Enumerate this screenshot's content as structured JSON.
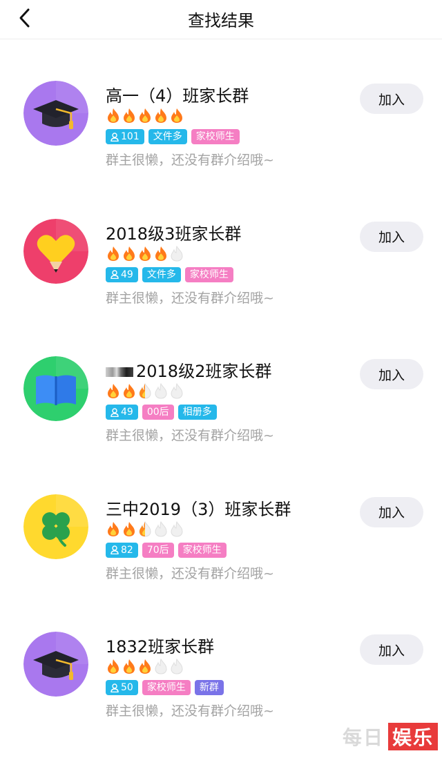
{
  "header": {
    "title": "查找结果"
  },
  "groups": [
    {
      "name": "高一（4）班家长群",
      "heat": 5,
      "members": "101",
      "tags": [
        "文件多",
        "家校师生"
      ],
      "tag_colors": [
        "blue",
        "pink"
      ],
      "desc": "群主很懒，还没有群介绍哦~",
      "join": "加入",
      "avatar_icon": "graduation-cap-icon",
      "avatar_color": "#a978ee"
    },
    {
      "name": "2018级3班家长群",
      "heat": 4,
      "members": "49",
      "tags": [
        "文件多",
        "家校师生"
      ],
      "tag_colors": [
        "blue",
        "pink"
      ],
      "desc": "群主很懒，还没有群介绍哦~",
      "join": "加入",
      "avatar_icon": "heart-pencil-icon",
      "avatar_color": "#ee3f6b"
    },
    {
      "name": "2018级2班家长群",
      "heat": 2.5,
      "members": "49",
      "tags": [
        "00后",
        "相册多"
      ],
      "tag_colors": [
        "pink",
        "blue"
      ],
      "desc": "群主很懒，还没有群介绍哦~",
      "join": "加入",
      "avatar_icon": "book-icon",
      "avatar_color": "#2ecf6e"
    },
    {
      "name": "三中2019（3）班家长群",
      "heat": 2.5,
      "members": "82",
      "tags": [
        "70后",
        "家校师生"
      ],
      "tag_colors": [
        "pink",
        "pink"
      ],
      "desc": "群主很懒，还没有群介绍哦~",
      "join": "加入",
      "avatar_icon": "clover-icon",
      "avatar_color": "#ffd92e"
    },
    {
      "name": "1832班家长群",
      "heat": 3,
      "members": "50",
      "tags": [
        "家校师生",
        "新群"
      ],
      "tag_colors": [
        "pink",
        "purple"
      ],
      "desc": "群主很懒，还没有群介绍哦~",
      "join": "加入",
      "avatar_icon": "graduation-cap-icon",
      "avatar_color": "#a978ee"
    }
  ],
  "watermark": {
    "part1": "每日",
    "part2": "娱乐"
  }
}
